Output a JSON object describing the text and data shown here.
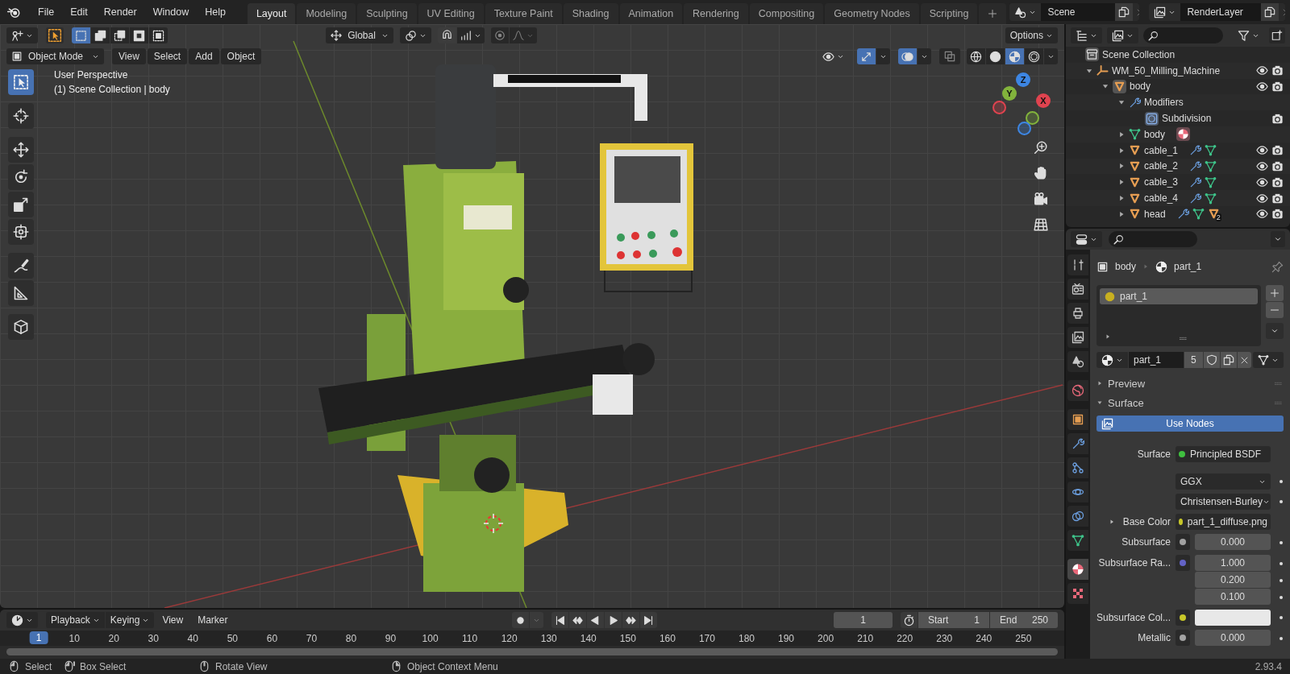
{
  "menu": [
    "File",
    "Edit",
    "Render",
    "Window",
    "Help"
  ],
  "workspaces": [
    {
      "label": "Layout",
      "selected": true
    },
    {
      "label": "Modeling",
      "selected": false
    },
    {
      "label": "Sculpting",
      "selected": false
    },
    {
      "label": "UV Editing",
      "selected": false
    },
    {
      "label": "Texture Paint",
      "selected": false
    },
    {
      "label": "Shading",
      "selected": false
    },
    {
      "label": "Animation",
      "selected": false
    },
    {
      "label": "Rendering",
      "selected": false
    },
    {
      "label": "Compositing",
      "selected": false
    },
    {
      "label": "Geometry Nodes",
      "selected": false
    },
    {
      "label": "Scripting",
      "selected": false
    }
  ],
  "scene": "Scene",
  "view_layer": "RenderLayer",
  "viewport": {
    "select_modes": [
      {
        "kind": "set",
        "selected": true
      },
      {
        "kind": "extend",
        "selected": false
      },
      {
        "kind": "subtract",
        "selected": false
      },
      {
        "kind": "invert",
        "selected": false
      },
      {
        "kind": "intersect",
        "selected": false
      }
    ],
    "transform_orientation": "Global",
    "options": "Options",
    "mode": "Object Mode",
    "menus": [
      "View",
      "Select",
      "Add",
      "Object"
    ],
    "shading": [
      {
        "kind": "wireframe",
        "selected": false
      },
      {
        "kind": "solid",
        "selected": false
      },
      {
        "kind": "material",
        "selected": true
      },
      {
        "kind": "rendered",
        "selected": false
      }
    ],
    "info_title": "User Perspective",
    "info_subtitle": "(1) Scene Collection | body",
    "tools": [
      {
        "kind": "select",
        "selected": true
      },
      {
        "kind": "cursor",
        "selected": false
      },
      {
        "kind": "move",
        "selected": false
      },
      {
        "kind": "rotate",
        "selected": false
      },
      {
        "kind": "scale",
        "selected": false
      },
      {
        "kind": "transform",
        "selected": false
      },
      {
        "kind": "annotate",
        "selected": false
      },
      {
        "kind": "measure",
        "selected": false
      },
      {
        "kind": "add_cube",
        "selected": false
      }
    ],
    "gizmo": [
      {
        "label": "X",
        "color": "#e0434f"
      },
      {
        "label": "Y",
        "color": "#82b33c"
      },
      {
        "label": "Z",
        "color": "#3d86e3"
      }
    ]
  },
  "outliner": {
    "root": "Scene Collection",
    "items": [
      {
        "label": "WM_50_Milling_Machine",
        "kind": "empty",
        "expanded": true,
        "children": [
          {
            "label": "body",
            "kind": "object",
            "active": true,
            "expanded": true,
            "children": [
              {
                "label": "Modifiers",
                "kind": "modifiers",
                "expanded": true,
                "children": [
                  {
                    "label": "Subdivision",
                    "kind": "modifier"
                  }
                ]
              },
              {
                "label": "body",
                "kind": "mesh",
                "expanded": false,
                "badges": [
                  {
                    "kind": "material"
                  }
                ]
              },
              {
                "label": "cable_1",
                "kind": "object",
                "active": false,
                "expanded": false,
                "badges": [
                  {
                    "kind": "modifier"
                  },
                  {
                    "kind": "mesh"
                  }
                ]
              },
              {
                "label": "cable_2",
                "kind": "object",
                "active": false,
                "expanded": false,
                "badges": [
                  {
                    "kind": "modifier"
                  },
                  {
                    "kind": "mesh"
                  }
                ]
              },
              {
                "label": "cable_3",
                "kind": "object",
                "active": false,
                "expanded": false,
                "badges": [
                  {
                    "kind": "modifier"
                  },
                  {
                    "kind": "mesh"
                  }
                ]
              },
              {
                "label": "cable_4",
                "kind": "object",
                "active": false,
                "expanded": false,
                "badges": [
                  {
                    "kind": "modifier"
                  },
                  {
                    "kind": "mesh"
                  }
                ]
              },
              {
                "label": "head",
                "kind": "object",
                "active": false,
                "expanded": false,
                "badges": [
                  {
                    "kind": "modifier"
                  },
                  {
                    "kind": "mesh"
                  },
                  {
                    "kind": "object"
                  }
                ],
                "badge_count": "2"
              }
            ]
          }
        ]
      }
    ]
  },
  "properties": {
    "tabs": [
      {
        "kind": "tool",
        "selected": false
      },
      {
        "kind": "render",
        "selected": false
      },
      {
        "kind": "output",
        "selected": false
      },
      {
        "kind": "view_layer",
        "selected": false
      },
      {
        "kind": "scene",
        "selected": false
      },
      {
        "kind": "world",
        "selected": false
      },
      {
        "kind": "object",
        "selected": false
      },
      {
        "kind": "modifiers",
        "selected": false
      },
      {
        "kind": "particles",
        "selected": false
      },
      {
        "kind": "physics",
        "selected": false
      },
      {
        "kind": "constraints",
        "selected": false
      },
      {
        "kind": "data",
        "selected": false
      },
      {
        "kind": "material",
        "selected": true
      },
      {
        "kind": "texture",
        "selected": false
      }
    ],
    "breadcrumb": [
      "body",
      "part_1"
    ],
    "slots": [
      {
        "label": "part_1",
        "selected": true
      }
    ],
    "material": {
      "name": "part_1",
      "users": "5"
    },
    "panels": [
      {
        "label": "Preview",
        "expanded": false
      },
      {
        "label": "Surface",
        "expanded": true
      }
    ],
    "use_nodes": "Use Nodes",
    "fields": [
      {
        "kind": "link",
        "label": "Surface",
        "value": "Principled BSDF",
        "color": "#3fbf3f",
        "expandable": false
      },
      {
        "kind": "dropdown",
        "value": "GGX"
      },
      {
        "kind": "dropdown",
        "value": "Christensen-Burley"
      },
      {
        "kind": "link",
        "label": "Base Color",
        "value": "part_1_diffuse.png",
        "color": "#c7c729",
        "expandable": true
      },
      {
        "kind": "number",
        "label": "Subsurface",
        "values": [
          "0.000"
        ],
        "color": "#a1a1a1"
      },
      {
        "kind": "number",
        "label": "Subsurface Ra...",
        "values": [
          "1.000",
          "0.200",
          "0.100"
        ],
        "color": "#6363c7"
      },
      {
        "kind": "swatch",
        "label": "Subsurface Col...",
        "color": "#c7c729",
        "swatch": {
          "color": "#e8e8e8"
        }
      },
      {
        "kind": "number",
        "label": "Metallic",
        "values": [
          "0.000"
        ],
        "color": "#a1a1a1"
      }
    ]
  },
  "timeline": {
    "menus": [
      {
        "label": "Playback",
        "dropdown": true
      },
      {
        "label": "Keying",
        "dropdown": true
      },
      {
        "label": "View",
        "dropdown": false
      },
      {
        "label": "Marker",
        "dropdown": false
      }
    ],
    "current_frame": "1",
    "start_label": "Start",
    "start": "1",
    "end_label": "End",
    "end": "250",
    "ruler": [
      "10",
      "20",
      "30",
      "40",
      "50",
      "60",
      "70",
      "80",
      "90",
      "100",
      "110",
      "120",
      "130",
      "140",
      "150",
      "160",
      "170",
      "180",
      "190",
      "200",
      "210",
      "220",
      "230",
      "240",
      "250"
    ],
    "playhead": "1"
  },
  "status": {
    "hints": [
      {
        "kind": "lmb",
        "label": "Select"
      },
      {
        "kind": "drag",
        "label": "Box Select"
      },
      {
        "kind": "mmb",
        "label": "Rotate View"
      },
      {
        "kind": "rmb",
        "label": "Object Context Menu"
      }
    ],
    "version": "2.93.4"
  }
}
